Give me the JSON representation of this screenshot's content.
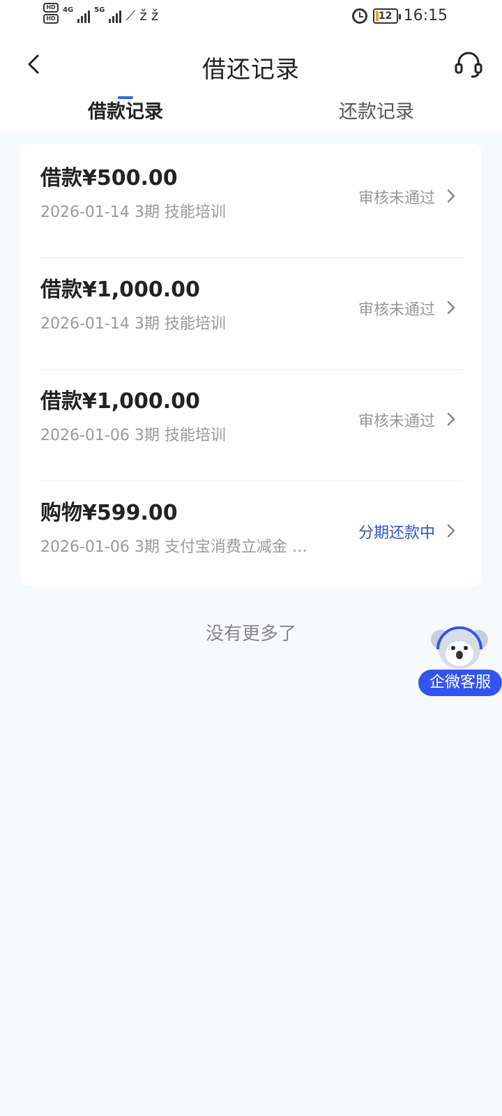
{
  "status_bar": {
    "hd1": "HD",
    "hd2": "HD",
    "net1": "4G",
    "net2": "5G",
    "battery": "12",
    "time": "16:15"
  },
  "header": {
    "title": "借还记录",
    "tabs": [
      {
        "label": "借款记录",
        "active": true
      },
      {
        "label": "还款记录",
        "active": false
      }
    ]
  },
  "records": [
    {
      "amount": "借款¥500.00",
      "meta": "2026-01-14 3期  技能培训",
      "status": "审核未通过",
      "status_color": "#999999"
    },
    {
      "amount": "借款¥1,000.00",
      "meta": "2026-01-14 3期  技能培训",
      "status": "审核未通过",
      "status_color": "#999999"
    },
    {
      "amount": "借款¥1,000.00",
      "meta": "2026-01-06 3期  技能培训",
      "status": "审核未通过",
      "status_color": "#999999"
    },
    {
      "amount": "购物¥599.00",
      "meta": "2026-01-06 3期  支付宝消费立减金 消...",
      "status": "分期还款中",
      "status_color": "#3352c8"
    }
  ],
  "list_end_text": "没有更多了",
  "float_service": {
    "label": "企微客服"
  },
  "colors": {
    "accent": "#3366ee",
    "background": "#f8f9fd"
  }
}
